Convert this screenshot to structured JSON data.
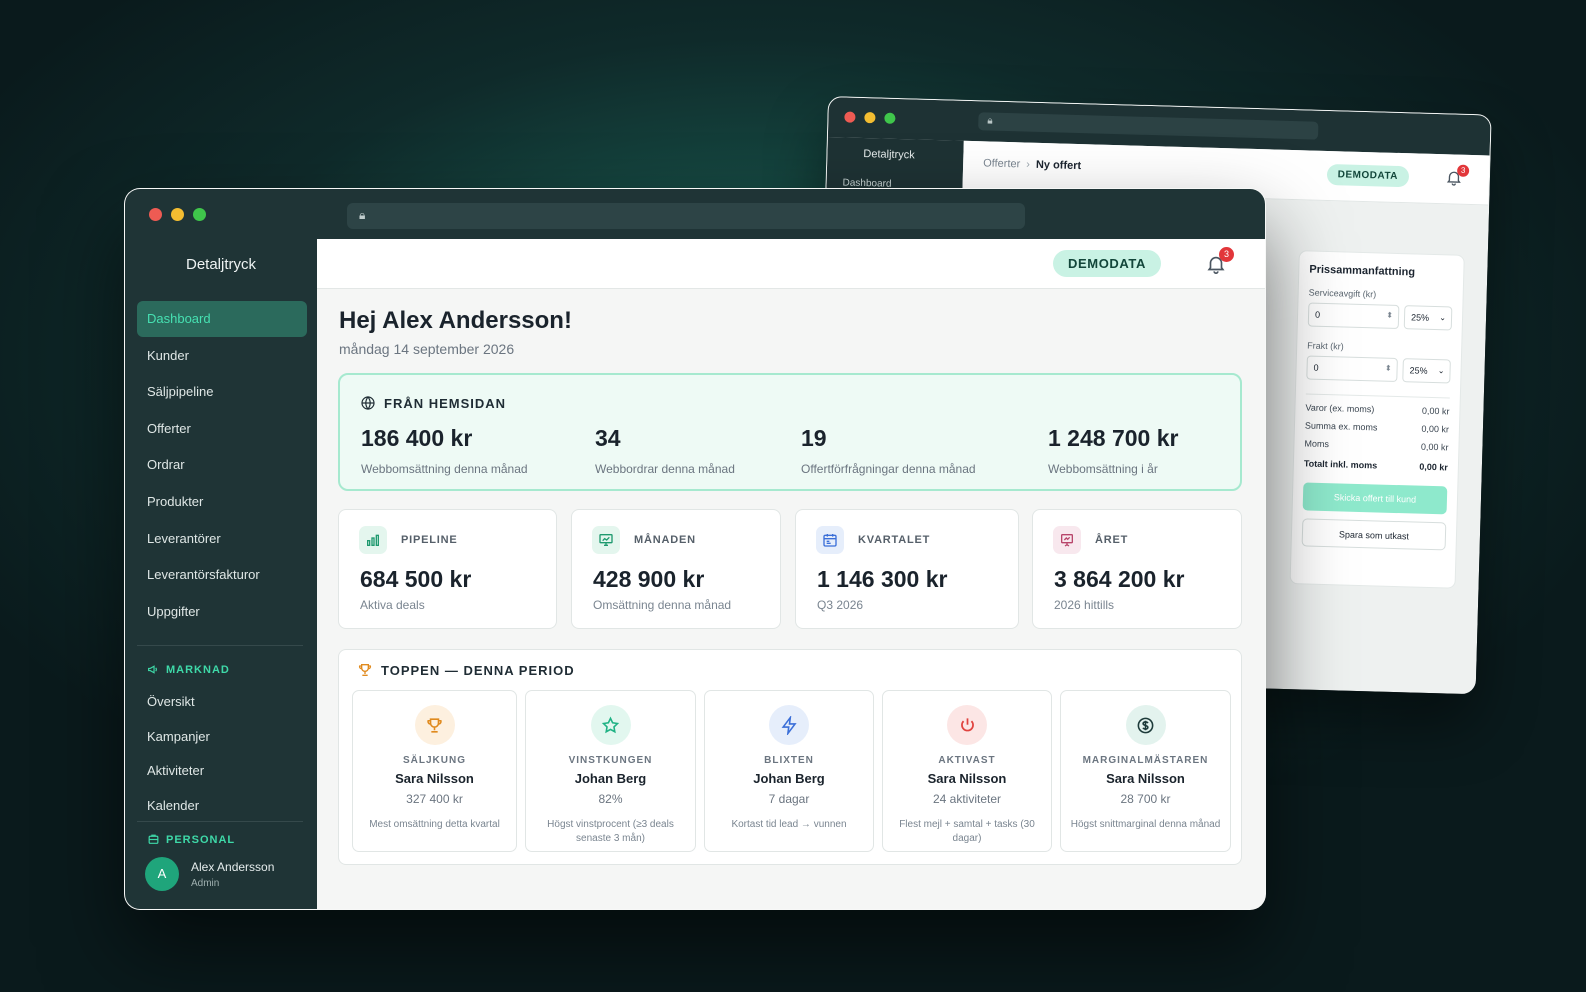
{
  "back_window": {
    "brand": "Detaljtryck",
    "sidebar_item": "Dashboard",
    "breadcrumb": {
      "parent": "Offerter",
      "current": "Ny offert"
    },
    "demo_label": "DEMODATA",
    "notification_count": "3",
    "pricing": {
      "title": "Prissammanfattning",
      "service_fee_label": "Serviceavgift (kr)",
      "service_fee_value": "0",
      "service_fee_vat": "25%",
      "shipping_label": "Frakt (kr)",
      "shipping_value": "0",
      "shipping_vat": "25%",
      "rows": [
        {
          "label": "Varor (ex. moms)",
          "value": "0,00 kr"
        },
        {
          "label": "Summa ex. moms",
          "value": "0,00 kr"
        },
        {
          "label": "Moms",
          "value": "0,00 kr"
        }
      ],
      "total_label": "Totalt inkl. moms",
      "total_value": "0,00 kr",
      "send_button": "Skicka offert till kund",
      "draft_button": "Spara som utkast"
    }
  },
  "app": {
    "brand": "Detaljtryck",
    "nav": [
      {
        "label": "Dashboard",
        "active": true
      },
      {
        "label": "Kunder"
      },
      {
        "label": "Säljpipeline"
      },
      {
        "label": "Offerter"
      },
      {
        "label": "Ordrar"
      },
      {
        "label": "Produkter"
      },
      {
        "label": "Leverantörer"
      },
      {
        "label": "Leverantörsfakturor"
      },
      {
        "label": "Uppgifter"
      }
    ],
    "marketing_section": "MARKNAD",
    "marketing_nav": [
      {
        "label": "Översikt"
      },
      {
        "label": "Kampanjer"
      },
      {
        "label": "Aktiviteter"
      },
      {
        "label": "Kalender"
      }
    ],
    "staff_section": "PERSONAL",
    "user": {
      "initial": "A",
      "name": "Alex Andersson",
      "role": "Admin"
    },
    "demo_label": "DEMODATA",
    "notification_count": "3"
  },
  "dashboard": {
    "greeting": "Hej Alex Andersson!",
    "date": "måndag 14 september 2026",
    "web": {
      "title": "FRÅN HEMSIDAN",
      "stats": [
        {
          "value": "186 400 kr",
          "label": "Webbomsättning denna månad"
        },
        {
          "value": "34",
          "label": "Webbordrar denna månad"
        },
        {
          "value": "19",
          "label": "Offertförfrågningar denna månad"
        },
        {
          "value": "1 248 700 kr",
          "label": "Webbomsättning i år"
        }
      ]
    },
    "kpis": [
      {
        "label": "PIPELINE",
        "value": "684 500 kr",
        "sub": "Aktiva deals",
        "icon": "bar-chart-icon",
        "color": "#1f9a6f",
        "bg": "#e4f6ee"
      },
      {
        "label": "MÅNADEN",
        "value": "428 900 kr",
        "sub": "Omsättning denna månad",
        "icon": "monitor-chart-icon",
        "color": "#1f9a6f",
        "bg": "#e4f6ee"
      },
      {
        "label": "KVARTALET",
        "value": "1 146 300 kr",
        "sub": "Q3 2026",
        "icon": "calendar-icon",
        "color": "#3b6fd8",
        "bg": "#e6eefb"
      },
      {
        "label": "ÅRET",
        "value": "3 864 200 kr",
        "sub": "2026 hittills",
        "icon": "presentation-chart-icon",
        "color": "#b8456b",
        "bg": "#f8e8ee"
      }
    ],
    "top": {
      "title": "TOPPEN — DENNA PERIOD",
      "awards": [
        {
          "title": "SÄLJKUNG",
          "name": "Sara Nilsson",
          "value": "327 400 kr",
          "desc": "Mest omsättning detta kvartal",
          "icon": "trophy-icon",
          "color": "#e08a1e",
          "bg": "#fdf0df"
        },
        {
          "title": "VINSTKUNGEN",
          "name": "Johan Berg",
          "value": "82%",
          "desc": "Högst vinstprocent (≥3 deals senaste 3 mån)",
          "icon": "star-icon",
          "color": "#1fb284",
          "bg": "#e2f7ef"
        },
        {
          "title": "BLIXTEN",
          "name": "Johan Berg",
          "value": "7 dagar",
          "desc": "Kortast tid lead → vunnen",
          "icon": "lightning-icon",
          "color": "#3b6fd8",
          "bg": "#e6eefb"
        },
        {
          "title": "AKTIVAST",
          "name": "Sara Nilsson",
          "value": "24 aktiviteter",
          "desc": "Flest mejl + samtal + tasks (30 dagar)",
          "icon": "power-icon",
          "color": "#e0433f",
          "bg": "#fce6e5"
        },
        {
          "title": "MARGINALMÄSTAREN",
          "name": "Sara Nilsson",
          "value": "28 700 kr",
          "desc": "Högst snittmarginal denna månad",
          "icon": "dollar-coin-icon",
          "color": "#1d3b3a",
          "bg": "#e3f3ee"
        }
      ]
    }
  }
}
